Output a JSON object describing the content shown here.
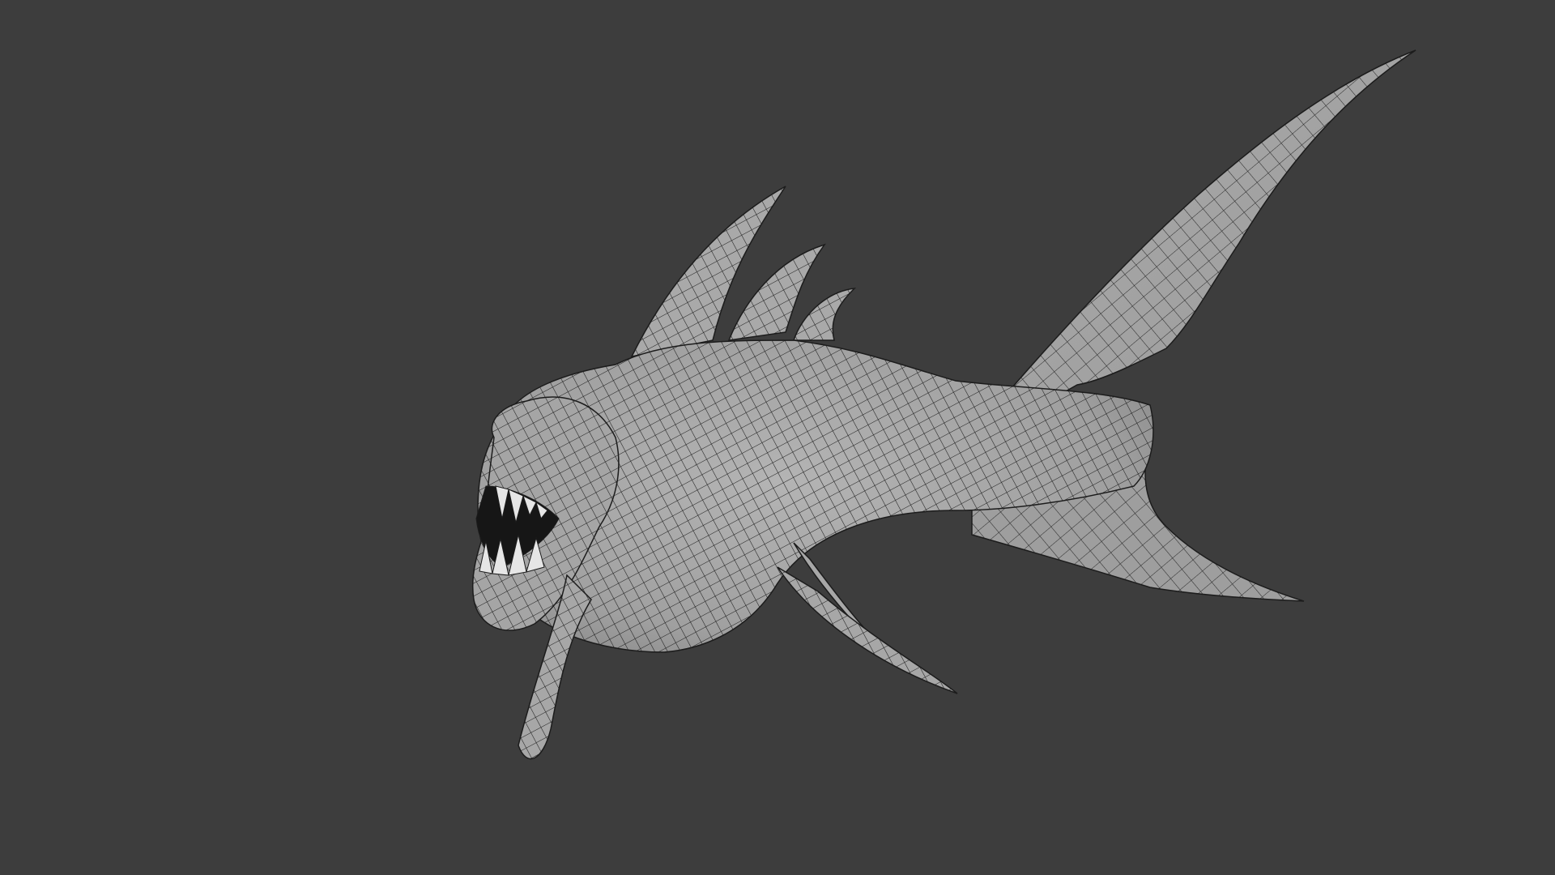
{
  "viewport": {
    "background_color": "#3d3d3d",
    "mesh_fill_color": "#a9a9a9",
    "mesh_shadow_color": "#858585",
    "wireframe_color": "#1c1c1c",
    "teeth_color": "#e6e6e6",
    "mouth_color": "#161616",
    "object": {
      "name": "",
      "description_icon": "mesh-object-icon"
    }
  }
}
